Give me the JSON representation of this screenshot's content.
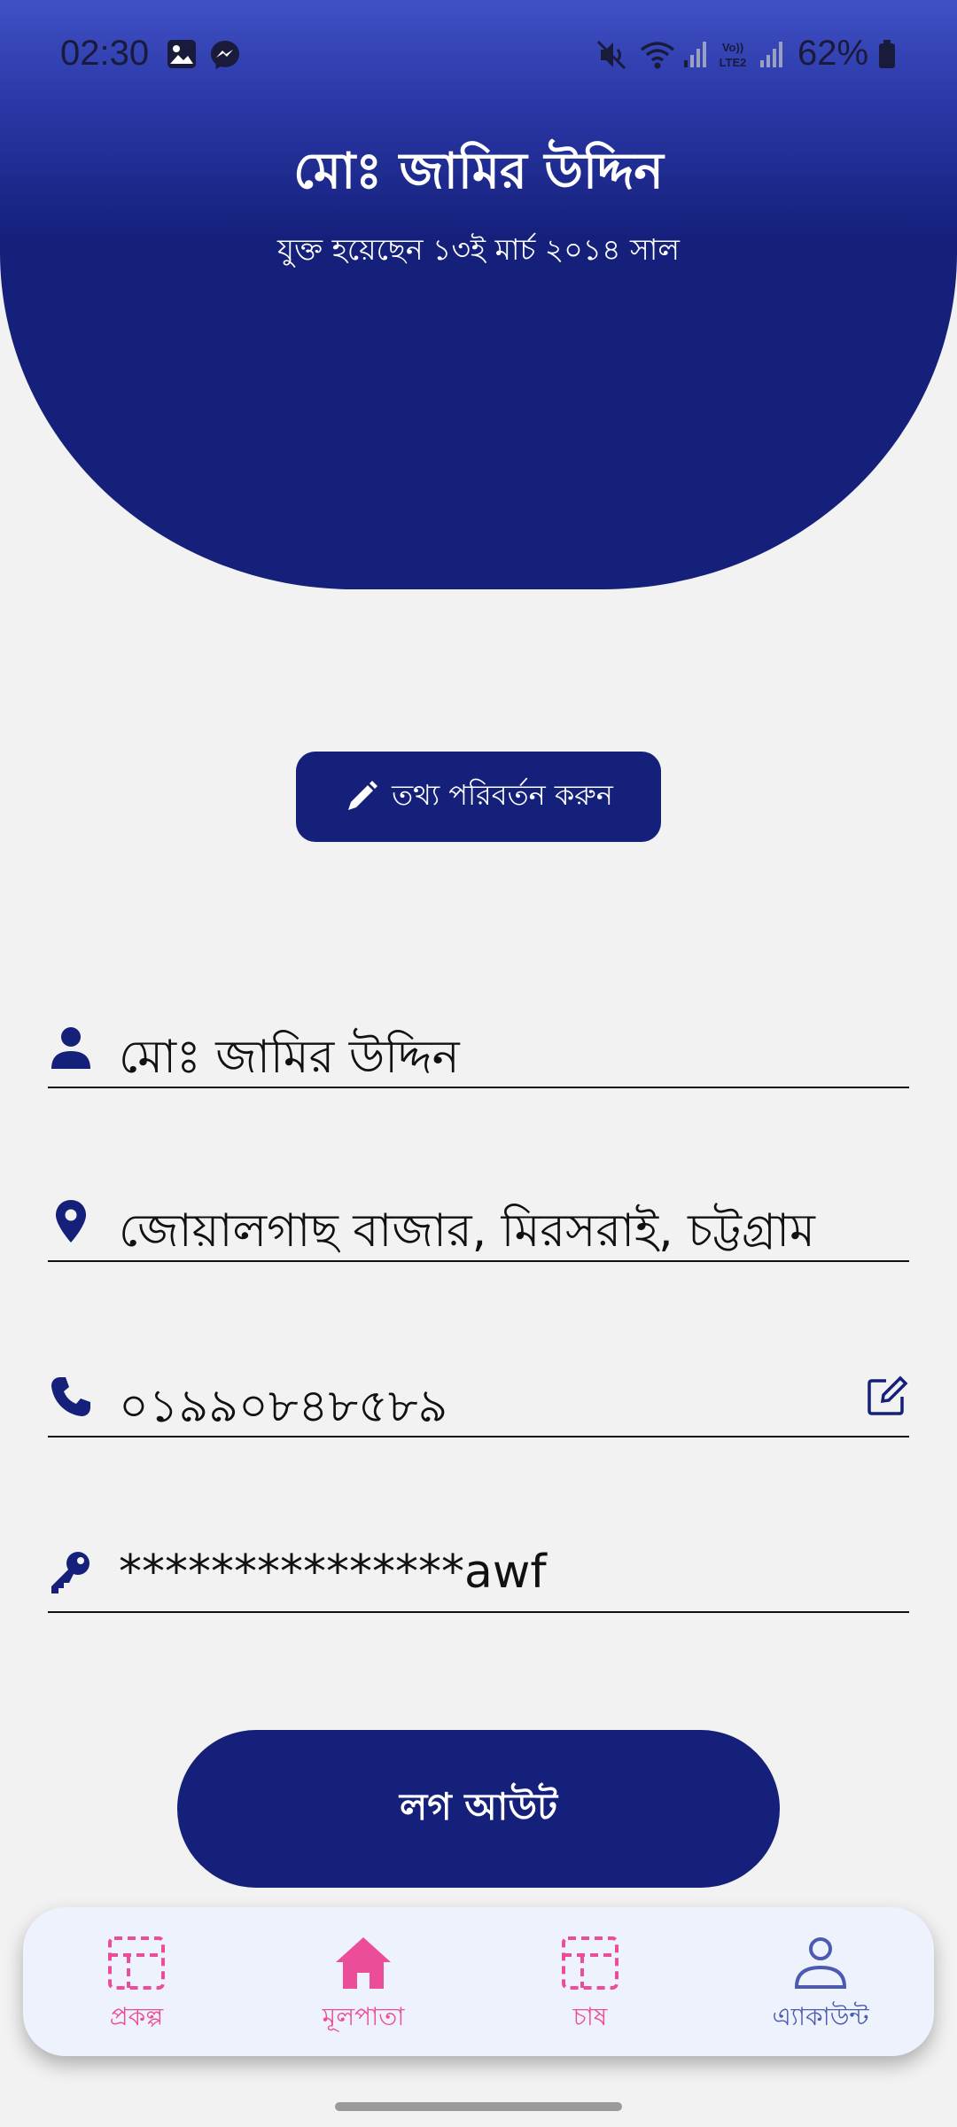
{
  "status_bar": {
    "time": "02:30",
    "battery": "62%",
    "icons": [
      "gallery-icon",
      "messenger-icon",
      "mute-icon",
      "wifi-icon",
      "signal-icon",
      "volte-icon",
      "signal-icon",
      "battery-icon"
    ]
  },
  "profile": {
    "name": "মোঃ জামির উদ্দিন",
    "joined": "যুক্ত হয়েছেন ১৩ই মার্চ ২০১৪ সাল"
  },
  "edit_info_button": {
    "label": "তথ্য পরিবর্তন করুন",
    "icon": "pencil-icon"
  },
  "info": {
    "name": "মোঃ জামির উদ্দিন",
    "address": "জোয়ালগাছ বাজার, মিরসরাই, চট্টগ্রাম",
    "phone": "০১৯৯০৮৪৮৫৮৯",
    "password": "***************awf"
  },
  "logout_button": {
    "label": "লগ আউট"
  },
  "bottom_nav": {
    "items": [
      {
        "label": "প্রকল্প",
        "icon": "dashed-grid-icon"
      },
      {
        "label": "মূলপাতা",
        "icon": "home-icon"
      },
      {
        "label": "চাষ",
        "icon": "dashed-grid-icon"
      },
      {
        "label": "এ্যাকাউন্ট",
        "icon": "person-icon"
      }
    ]
  },
  "colors": {
    "primary": "#14207a",
    "header_top": "#3f51c4",
    "background": "#f2f2f2",
    "nav_active": "#ec4d98",
    "nav_account": "#4c5bb0",
    "nav_background": "#edf2fd"
  }
}
